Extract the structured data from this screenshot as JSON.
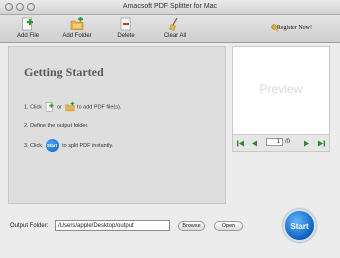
{
  "window": {
    "title": "Amacsoft PDF Splitter for Mac"
  },
  "toolbar": {
    "add_file": "Add File",
    "add_folder": "Add Folder",
    "delete": "Delete",
    "clear_all": "Clear All",
    "register": "Register Now!"
  },
  "getting_started": {
    "title": "Getting Started",
    "step1_prefix": "1. Click",
    "step1_or": "or",
    "step1_suffix": "to add PDF file(s).",
    "step2": "2. Define the output folder.",
    "step3_prefix": "3. Click",
    "step3_start": "Start",
    "step3_suffix": "to split PDF instantly."
  },
  "preview": {
    "label": "Preview",
    "current_page": "1",
    "total_pages": "/0"
  },
  "output": {
    "label": "Output Folder:",
    "path": "/Users/apple/Desktop/output",
    "browse": "Browse",
    "open": "Open"
  },
  "start_button": "Start",
  "colors": {
    "accent_blue": "#0b59b6",
    "add_green": "#2e9e2e"
  }
}
